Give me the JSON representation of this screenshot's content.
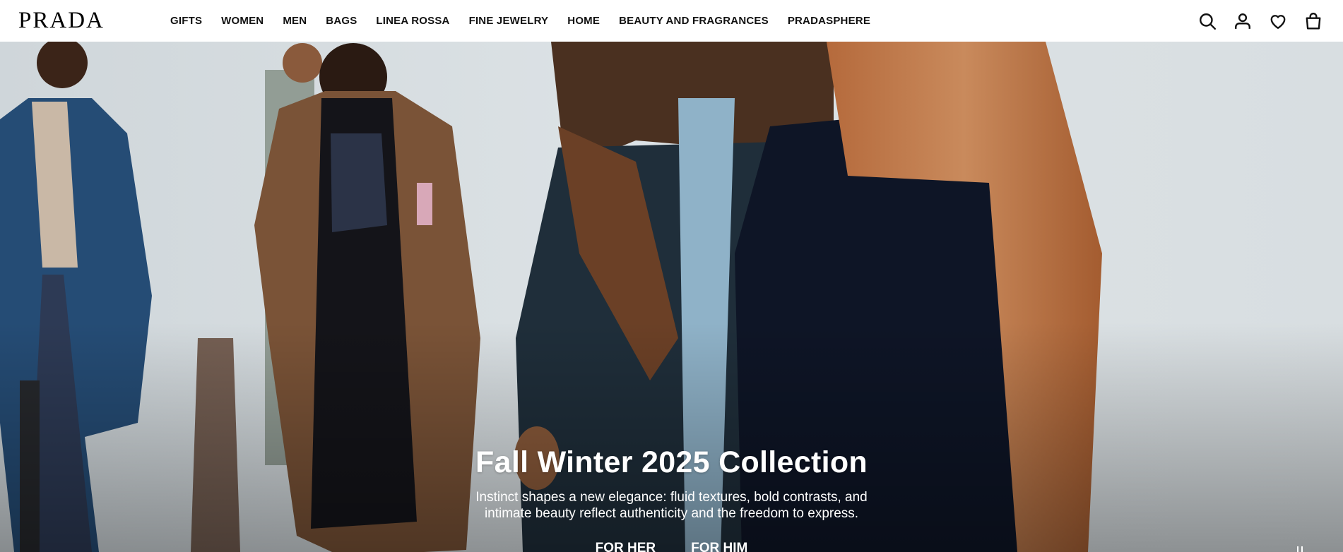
{
  "brand": {
    "logo_text": "PRADA"
  },
  "nav": {
    "items": [
      {
        "label": "GIFTS"
      },
      {
        "label": "WOMEN"
      },
      {
        "label": "MEN"
      },
      {
        "label": "BAGS"
      },
      {
        "label": "LINEA ROSSA"
      },
      {
        "label": "FINE JEWELRY"
      },
      {
        "label": "HOME"
      },
      {
        "label": "BEAUTY AND FRAGRANCES"
      },
      {
        "label": "PRADASPHERE"
      }
    ]
  },
  "header_icons": [
    "search-icon",
    "account-icon",
    "wishlist-icon",
    "bag-icon"
  ],
  "hero": {
    "title": "Fall Winter 2025 Collection",
    "description": "Instinct shapes a new elegance: fluid textures, bold contrasts, and intimate beauty reflect authenticity and the freedom to express.",
    "cta_her": "FOR HER",
    "cta_him": "FOR HIM",
    "pause_icon": "pause-icon"
  },
  "colors": {
    "header_bg": "#ffffff",
    "text_dark": "#111111",
    "hero_text": "#ffffff",
    "hero_bg": "#d7dde0"
  }
}
